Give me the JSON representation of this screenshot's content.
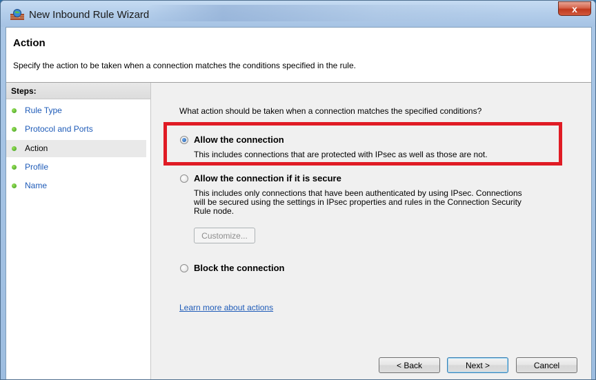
{
  "window": {
    "title": "New Inbound Rule Wizard",
    "close_label": "x"
  },
  "header": {
    "title": "Action",
    "description": "Specify the action to be taken when a connection matches the conditions specified in the rule."
  },
  "sidebar": {
    "steps_label": "Steps:",
    "items": [
      {
        "label": "Rule Type"
      },
      {
        "label": "Protocol and Ports"
      },
      {
        "label": "Action"
      },
      {
        "label": "Profile"
      },
      {
        "label": "Name"
      }
    ]
  },
  "main": {
    "question": "What action should be taken when a connection matches the specified conditions?",
    "options": [
      {
        "title": "Allow the connection",
        "description": "This includes connections that are protected with IPsec as well as those are not.",
        "selected": true
      },
      {
        "title": "Allow the connection if it is secure",
        "description_lines": [
          "This includes only connections that have been authenticated by using IPsec.  Connections",
          "will be secured using the settings in IPsec properties and rules in the Connection Security",
          "Rule node."
        ],
        "selected": false
      },
      {
        "title": "Block the connection",
        "selected": false
      }
    ],
    "customize_label": "Customize...",
    "learn_more_link": "Learn more about actions"
  },
  "buttons": {
    "back": "< Back",
    "next": "Next >",
    "cancel": "Cancel"
  },
  "colors": {
    "highlight": "#e01b24",
    "link": "#1e5bb8"
  }
}
